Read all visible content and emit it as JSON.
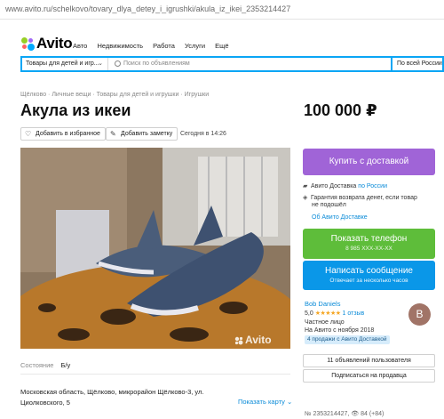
{
  "browser": {
    "url": "www.avito.ru/schelkovo/tovary_dlya_detey_i_igrushki/akula_iz_ikei_2353214427"
  },
  "header": {
    "logo_text": "Avito",
    "nav": [
      "Авто",
      "Недвижимость",
      "Работа",
      "Услуги",
      "Ещё"
    ],
    "search": {
      "category": "Товары для детей и игр...",
      "placeholder": "Поиск по объявлениям",
      "region": "По всей России"
    }
  },
  "breadcrumbs": "Щёлково · Личные вещи · Товары для детей и игрушки · Игрушки",
  "listing": {
    "title": "Акула из икеи",
    "price": "100 000 ₽",
    "add_favorite": "Добавить в избранное",
    "add_note": "Добавить заметку",
    "posted": "Сегодня в 14:26",
    "watermark": "Avito",
    "condition_label": "Состояние",
    "condition_value": "Б/у",
    "address": "Московская область, Щёлково, микрорайон Щёлково-3, ул. Циолковского, 5",
    "show_map": "Показать карту",
    "meta": "№ 2353214427, 👁 84 (+84)"
  },
  "sidebar": {
    "buy_delivery": "Купить с доставкой",
    "delivery_service": "Авито Доставка",
    "delivery_region": "по России",
    "guarantee": "Гарантия возврата денег, если товар",
    "guarantee2": "не подошёл",
    "about_delivery": "Об Авито Доставке",
    "show_phone": "Показать телефон",
    "phone_masked": "8 985 XXX-XX-XX",
    "write_message": "Написать сообщение",
    "reply_time": "Отвечает за несколько часов",
    "seller": {
      "name": "Bob Daniels",
      "rating_value": "5,0",
      "stars": "★★★★★",
      "reviews": "1 отзыв",
      "type": "Частное лицо",
      "since": "На Авито с ноября 2018",
      "badge": "4 продажи с Авито Доставкой",
      "avatar_letter": "B"
    },
    "user_ads": "11 объявлений пользователя",
    "subscribe": "Подписаться на продавца"
  },
  "colors": {
    "delivery_btn": "#a064d7",
    "phone_btn": "#5ebd3a",
    "message_btn": "#0a97e8",
    "link": "#0a8bd8",
    "search_border": "#0aa6f5"
  }
}
